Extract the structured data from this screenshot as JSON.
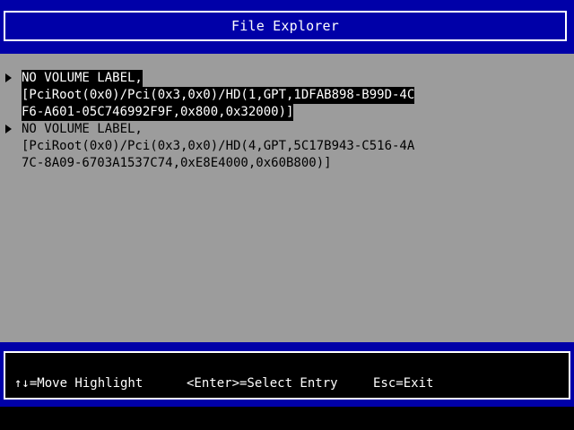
{
  "header": {
    "title": "File Explorer"
  },
  "entries": [
    {
      "highlighted": true,
      "line1": "NO VOLUME LABEL,",
      "line2": "[PciRoot(0x0)/Pci(0x3,0x0)/HD(1,GPT,1DFAB898-B99D-4C",
      "line3": "F6-A601-05C746992F9F,0x800,0x32000)]"
    },
    {
      "highlighted": false,
      "line1": "NO VOLUME LABEL,",
      "line2": "[PciRoot(0x0)/Pci(0x3,0x0)/HD(4,GPT,5C17B943-C516-4A",
      "line3": "7C-8A09-6703A1537C74,0xE8E4000,0x60B800)]"
    }
  ],
  "footer": {
    "move_hint": "↑↓=Move Highlight",
    "enter_hint": "<Enter>=Select Entry",
    "esc_hint": "Esc=Exit"
  },
  "colors": {
    "header_background": "#0000a8",
    "content_background": "#9c9c9c",
    "highlight_background": "#000000",
    "text": "#ffffff"
  },
  "icons": {
    "entry_marker": "right-triangle-icon"
  }
}
